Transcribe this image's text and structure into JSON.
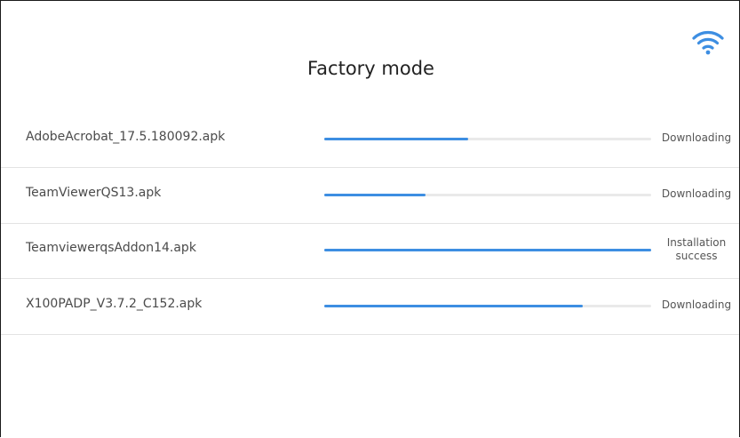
{
  "screen": {
    "title": "Factory mode",
    "wifi_icon": "wifi-icon",
    "accent_color": "#3d8ee2"
  },
  "downloads": [
    {
      "file_name": "AdobeAcrobat_17.5.180092.apk",
      "progress": 0.44,
      "status": "Downloading"
    },
    {
      "file_name": "TeamViewerQS13.apk",
      "progress": 0.31,
      "status": "Downloading"
    },
    {
      "file_name": "TeamviewerqsAddon14.apk",
      "progress": 1.0,
      "status_line1": "Installation",
      "status_line2": "success"
    },
    {
      "file_name": "X100PADP_V3.7.2_C152.apk",
      "progress": 0.79,
      "status": "Downloading"
    }
  ]
}
